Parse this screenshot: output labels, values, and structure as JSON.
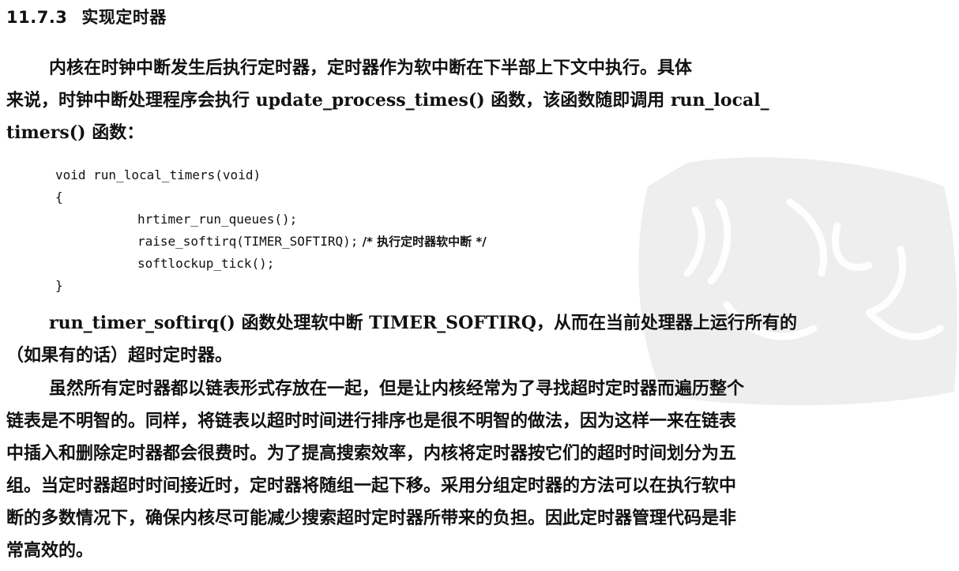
{
  "section": {
    "number": "11.7.3",
    "title": "实现定时器"
  },
  "paragraph1": [
    "内核在时钟中断发生后执行定时器，定时器作为软中断在下半部上下文中执行。具体",
    "来说，时钟中断处理程序会执行 update_process_times() 函数，该函数随即调用 run_local_",
    "timers() 函数："
  ],
  "code": {
    "signature": "void run_local_timers(void)",
    "open_brace": "{",
    "line1": "hrtimer_run_queues();",
    "line2": "raise_softirq(TIMER_SOFTIRQ);",
    "line2_comment": " /* 执行定时器软中断 */",
    "line3": "softlockup_tick();",
    "close_brace": "}"
  },
  "paragraph2": [
    "run_timer_softirq() 函数处理软中断 TIMER_SOFTIRQ，从而在当前处理器上运行所有的",
    "（如果有的话）超时定时器。"
  ],
  "paragraph3": [
    "虽然所有定时器都以链表形式存放在一起，但是让内核经常为了寻找超时定时器而遍历整个",
    "链表是不明智的。同样，将链表以超时时间进行排序也是很不明智的做法，因为这样一来在链表",
    "中插入和删除定时器都会很费时。为了提高搜索效率，内核将定时器按它们的超时时间划分为五",
    "组。当定时器超时时间接近时，定时器将随组一起下移。采用分组定时器的方法可以在执行软中",
    "断的多数情况下，确保内核尽可能减少搜索超时定时器所带来的负担。因此定时器管理代码是非",
    "常高效的。"
  ]
}
